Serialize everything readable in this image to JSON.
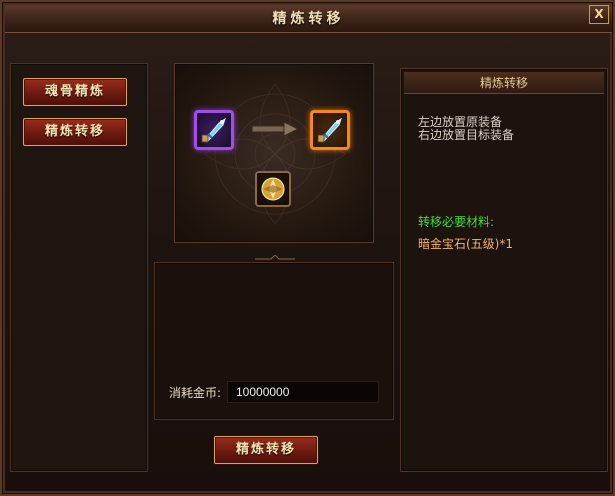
{
  "window": {
    "title": "精炼转移",
    "close_label": "X"
  },
  "sidebar": {
    "items": [
      {
        "label": "魂骨精炼"
      },
      {
        "label": "精炼转移"
      }
    ]
  },
  "slots": {
    "source_icon": "blue-sword-equipment-icon",
    "target_icon": "blue-sword-equipment-icon",
    "material_icon": "gold-gem-icon",
    "arrow_icon": "right-arrow-icon",
    "source_border_color": "#a24ee6",
    "target_border_color": "#f08a1a"
  },
  "cost": {
    "label": "消耗金币:",
    "value": "10000000"
  },
  "actions": {
    "transfer_label": "精炼转移"
  },
  "info": {
    "header": "精炼转移",
    "desc_line1": "左边放置原装备",
    "desc_line2": "右边放置目标装备",
    "required_title": "转移必要材料:",
    "required_item": "暗金宝石(五级)*1",
    "required_title_color": "#3fdc3a",
    "required_item_color": "#f2b46a"
  }
}
